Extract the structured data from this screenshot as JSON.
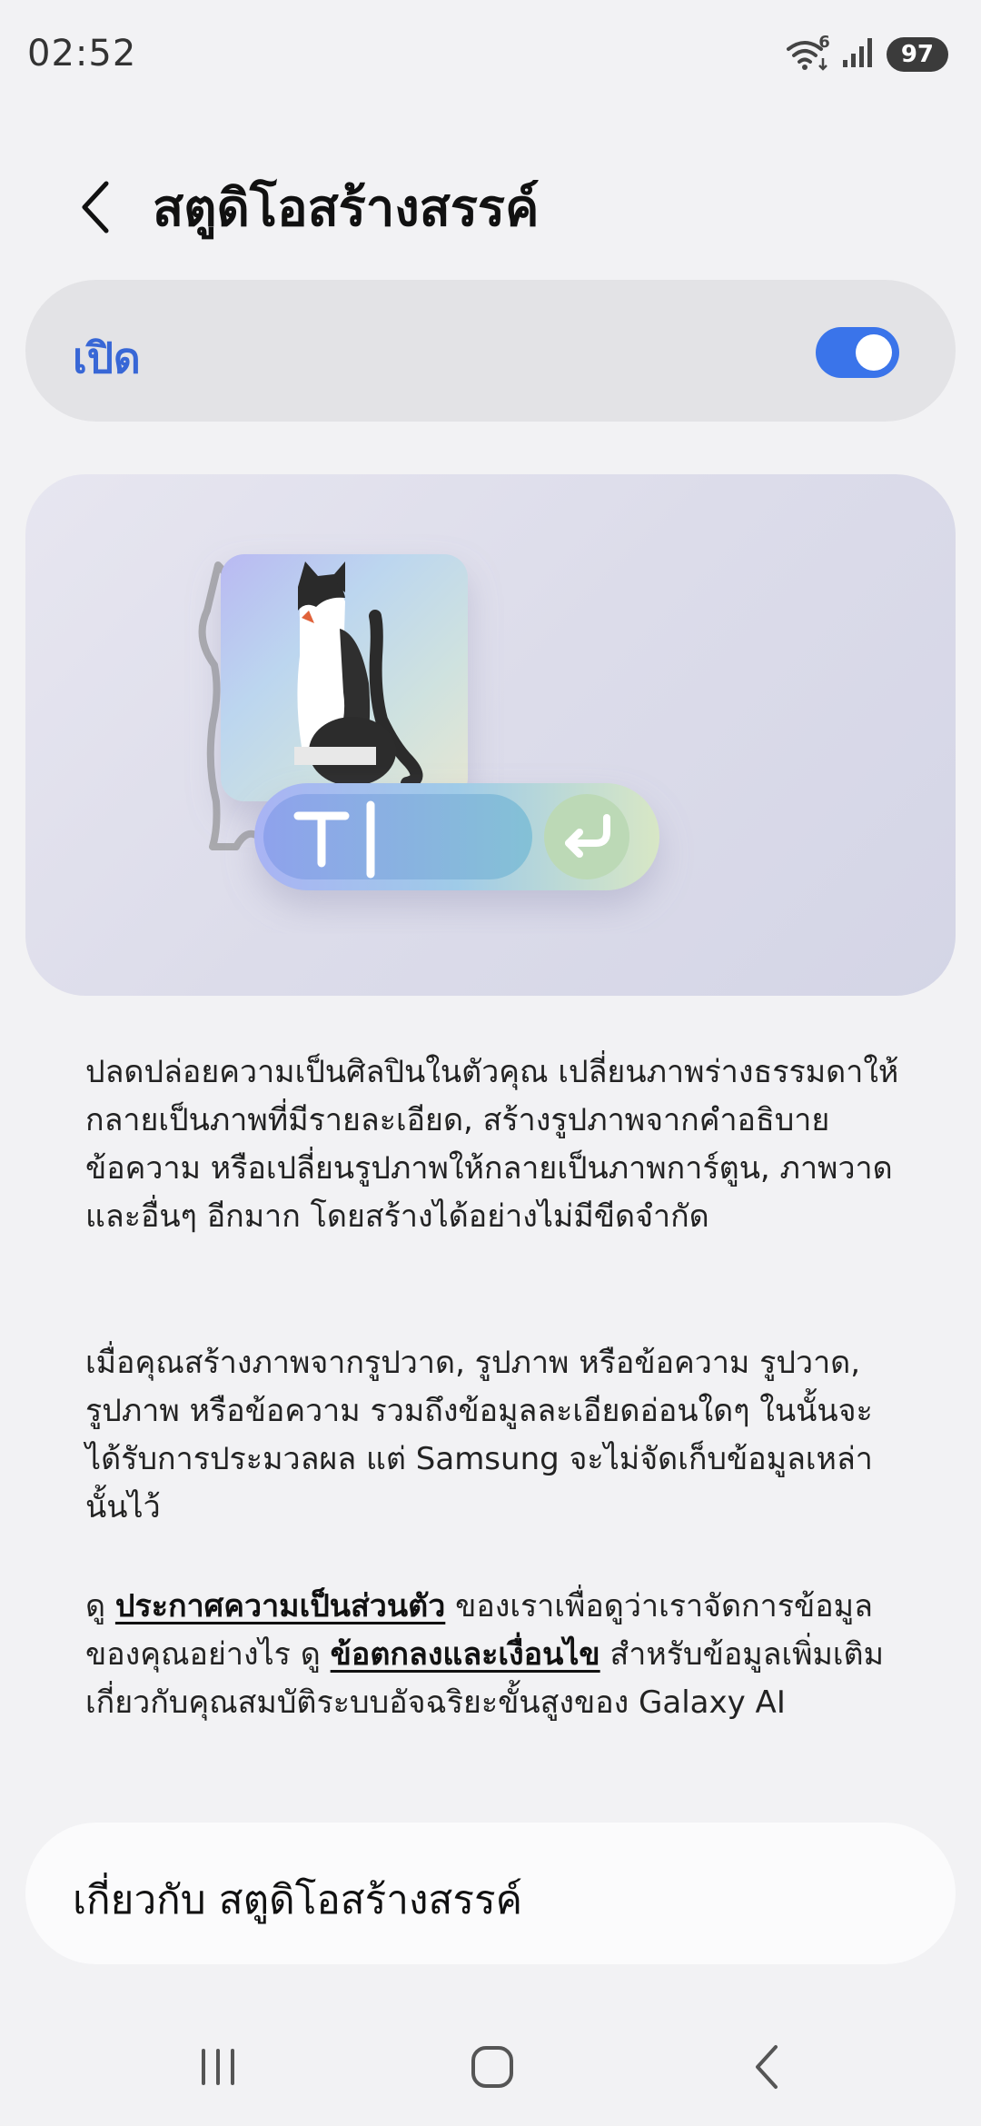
{
  "status_bar": {
    "time": "02:52",
    "wifi_badge": "6",
    "battery": "97",
    "icons": [
      "wifi-icon",
      "signal-icon",
      "battery-icon"
    ]
  },
  "header": {
    "title": "สตูดิโอสร้างสรรค์",
    "back_icon": "chevron-left-icon"
  },
  "toggle": {
    "label": "เปิด",
    "checked": true
  },
  "description": {
    "paragraph_1": "ปลดปล่อยความเป็นศิลปินในตัวคุณ เปลี่ยนภาพร่างธรรมดาให้กลายเป็นภาพที่มีรายละเอียด, สร้างรูปภาพจากคำอธิบายข้อความ หรือเปลี่ยนรูปภาพให้กลายเป็นภาพการ์ตูน, ภาพวาด และอื่นๆ อีกมาก โดยสร้างได้อย่างไม่มีขีดจำกัด",
    "paragraph_2": "เมื่อคุณสร้างภาพจากรูปวาด, รูปภาพ หรือข้อความ รูปวาด, รูปภาพ หรือข้อความ รวมถึงข้อมูลละเอียดอ่อนใดๆ ในนั้นจะได้รับการประมวลผล แต่ Samsung จะไม่จัดเก็บข้อมูลเหล่านั้นไว้",
    "paragraph_3_prefix": "ดู ",
    "privacy_link": "ประกาศความเป็นส่วนตัว",
    "paragraph_3_middle": " ของเราเพื่อดูว่าเราจัดการข้อมูลของคุณอย่างไร ดู ",
    "terms_link": "ข้อตกลงและเงื่อนไข",
    "paragraph_3_suffix": " สำหรับข้อมูลเพิ่มเติมเกี่ยวกับคุณสมบัติระบบอัจฉริยะขั้นสูงของ Galaxy AI"
  },
  "about": {
    "label": "เกี่ยวกับ สตูดิโอสร้างสรรค์"
  },
  "nav_bar": {
    "icons": [
      "recents-icon",
      "home-icon",
      "back-icon"
    ]
  },
  "colors": {
    "accent": "#3a74ea",
    "background": "#f2f2f4",
    "card": "#e3e3e6"
  }
}
